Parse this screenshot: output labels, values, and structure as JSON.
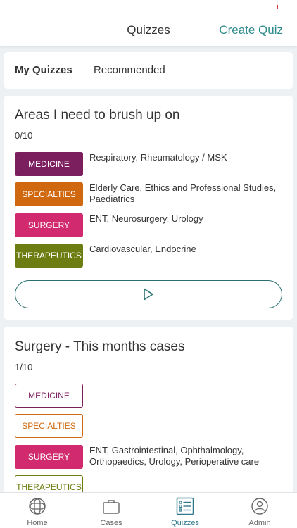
{
  "header": {
    "title": "Quizzes",
    "action_label": "Create Quiz"
  },
  "tabs": {
    "active": "My Quizzes",
    "inactive": "Recommended"
  },
  "quiz_cards": [
    {
      "title": "Areas I need to brush up on",
      "score": "0/10",
      "rows": [
        {
          "category": "MEDICINE",
          "topics": "Respiratory, Rheumatology / MSK"
        },
        {
          "category": "SPECIALTIES",
          "topics": "Elderly Care, Ethics and Professional Studies, Paediatrics"
        },
        {
          "category": "SURGERY",
          "topics": "ENT, Neurosurgery, Urology"
        },
        {
          "category": "THERAPEUTICS",
          "topics": "Cardiovascular, Endocrine"
        }
      ]
    },
    {
      "title": "Surgery - This months cases",
      "score": "1/10",
      "rows": [
        {
          "category": "MEDICINE",
          "topics": ""
        },
        {
          "category": "SPECIALTIES",
          "topics": ""
        },
        {
          "category": "SURGERY",
          "topics": "ENT, Gastrointestinal, Ophthalmology, Orthopaedics, Urology, Perioperative care"
        },
        {
          "category": "THERAPEUTICS",
          "topics": ""
        }
      ]
    }
  ],
  "colors": {
    "medicine": "#7c1f5f",
    "specialties": "#d0680f",
    "surgery": "#d22a6e",
    "therapeutics": "#6e7d12",
    "accent": "#2f8a8a"
  },
  "bottom_nav": [
    {
      "label": "Home",
      "icon": "home-globe-icon"
    },
    {
      "label": "Cases",
      "icon": "briefcase-icon"
    },
    {
      "label": "Quizzes",
      "icon": "quiz-list-icon"
    },
    {
      "label": "Admin",
      "icon": "user-circle-icon"
    }
  ],
  "play_button_icon": "play-icon"
}
